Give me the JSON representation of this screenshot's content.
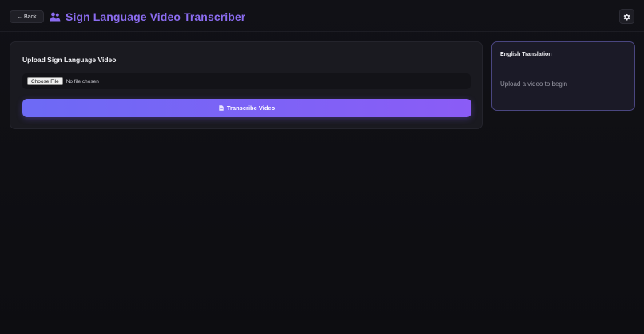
{
  "header": {
    "back_label": "← Back",
    "title": "Sign Language Video Transcriber",
    "title_icon": "people-icon",
    "settings_icon": "gear-icon"
  },
  "upload": {
    "heading": "Upload Sign Language Video",
    "choose_file_label": "Choose File",
    "file_status": "No file chosen",
    "transcribe_label": "Transcribe Video",
    "transcribe_icon": "document-icon"
  },
  "translation": {
    "heading": "English Translation",
    "placeholder": "Upload a video to begin"
  },
  "colors": {
    "accent": "#8b6cf0",
    "button_gradient_start": "#6d6af5",
    "button_gradient_end": "#8b5cf6",
    "background": "#0f0f13",
    "card": "#1a1a20",
    "translation_border": "#4a4680"
  }
}
